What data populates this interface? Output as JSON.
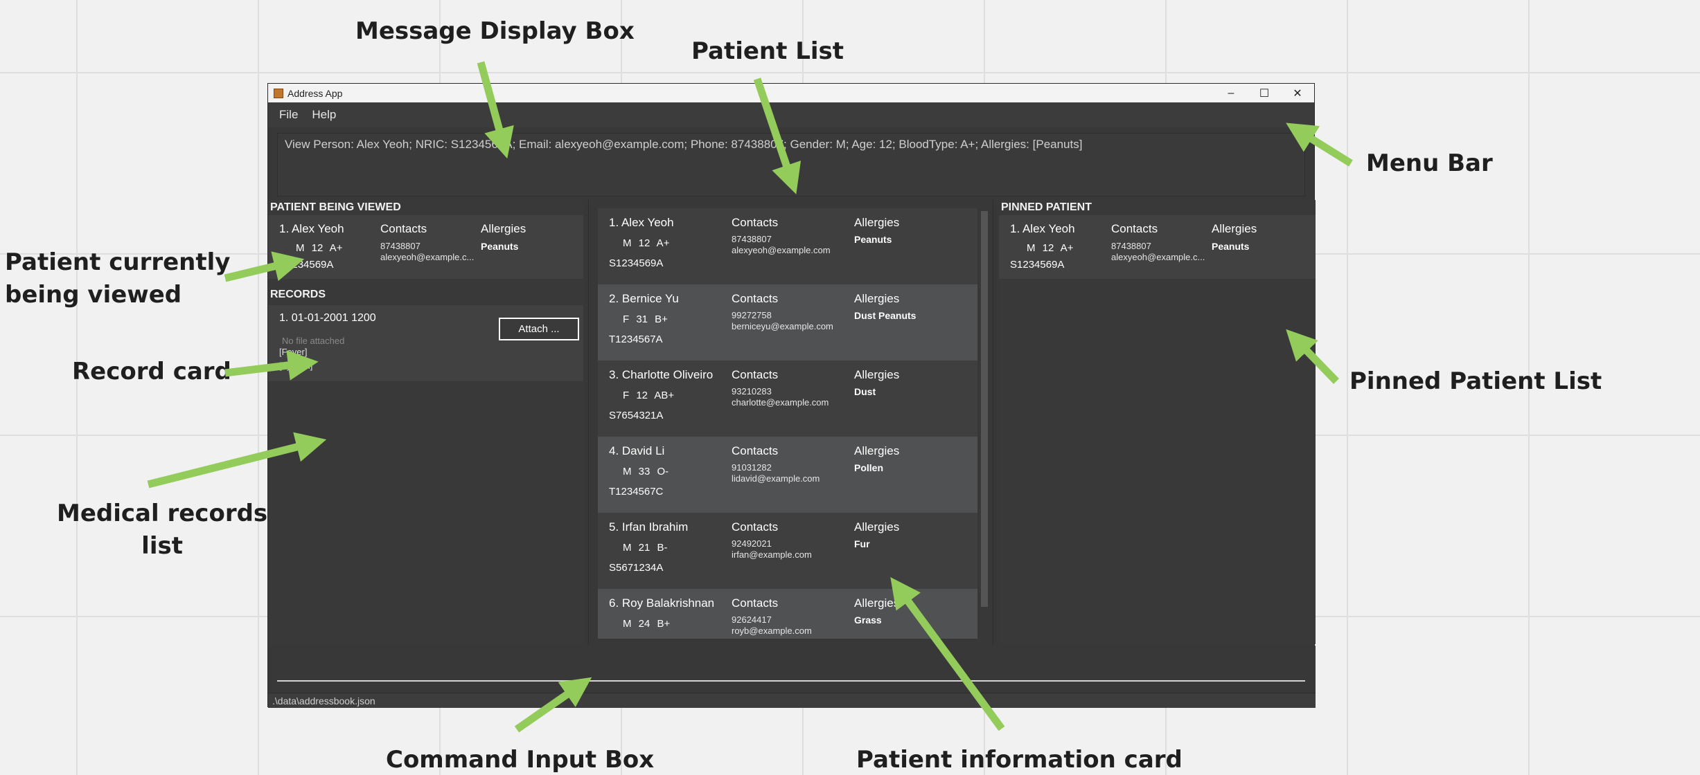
{
  "annotations": {
    "message_display_box": "Message Display Box",
    "patient_list": "Patient List",
    "menu_bar": "Menu Bar",
    "patient_viewed_line1": "Patient currently",
    "patient_viewed_line2": "being viewed",
    "record_card": "Record card",
    "medical_records_line1": "Medical records",
    "medical_records_line2": "list",
    "pinned_patient_list": "Pinned Patient List",
    "command_input_box": "Command Input Box",
    "patient_info_card": "Patient information card",
    "arrow_color": "#93cc5a"
  },
  "window": {
    "title": "Address App",
    "controls": {
      "minimize": "–",
      "maximize": "☐",
      "close": "✕"
    }
  },
  "menu": {
    "file": "File",
    "help": "Help"
  },
  "message": "View Person: Alex Yeoh; NRIC: S1234569A; Email: alexyeoh@example.com; Phone: 87438807; Gender: M; Age: 12; BloodType: A+; Allergies: [Peanuts]",
  "viewed": {
    "section_title": "PATIENT BEING VIEWED",
    "name": "1. Alex Yeoh",
    "attrs": "M 12 A+",
    "nric": "S1234569A",
    "contacts_title": "Contacts",
    "phone": "87438807",
    "email": "alexyeoh@example.c...",
    "allergies_title": "Allergies",
    "allergies": "Peanuts"
  },
  "records": {
    "section_title": "RECORDS",
    "items": [
      {
        "date": "1. 01-01-2001 1200",
        "file_status": "No file attached",
        "line1": "[Fever]",
        "line2": "[Tylenol]",
        "attach_label": "Attach ..."
      }
    ]
  },
  "patients": [
    {
      "name": "1. Alex Yeoh",
      "attrs": "M 12 A+",
      "nric": "S1234569A",
      "contacts_title": "Contacts",
      "phone": "87438807",
      "email": "alexyeoh@example.com",
      "allergies_title": "Allergies",
      "allergies": "Peanuts"
    },
    {
      "name": "2. Bernice Yu",
      "attrs": "F 31 B+",
      "nric": "T1234567A",
      "contacts_title": "Contacts",
      "phone": "99272758",
      "email": "berniceyu@example.com",
      "allergies_title": "Allergies",
      "allergies": "Dust Peanuts"
    },
    {
      "name": "3. Charlotte Oliveiro",
      "attrs": "F 12 AB+",
      "nric": "S7654321A",
      "contacts_title": "Contacts",
      "phone": "93210283",
      "email": "charlotte@example.com",
      "allergies_title": "Allergies",
      "allergies": "Dust"
    },
    {
      "name": "4. David Li",
      "attrs": "M 33 O-",
      "nric": "T1234567C",
      "contacts_title": "Contacts",
      "phone": "91031282",
      "email": "lidavid@example.com",
      "allergies_title": "Allergies",
      "allergies": "Pollen"
    },
    {
      "name": "5. Irfan Ibrahim",
      "attrs": "M 21 B-",
      "nric": "S5671234A",
      "contacts_title": "Contacts",
      "phone": "92492021",
      "email": "irfan@example.com",
      "allergies_title": "Allergies",
      "allergies": "Fur"
    },
    {
      "name": "6. Roy Balakrishnan",
      "attrs": "M 24 B+",
      "nric": "",
      "contacts_title": "Contacts",
      "phone": "92624417",
      "email": "royb@example.com",
      "allergies_title": "Allergies",
      "allergies": "Grass"
    }
  ],
  "pinned": {
    "section_title": "PINNED PATIENT",
    "name": "1. Alex Yeoh",
    "attrs": "M 12 A+",
    "nric": "S1234569A",
    "contacts_title": "Contacts",
    "phone": "87438807",
    "email": "alexyeoh@example.c...",
    "allergies_title": "Allergies",
    "allergies": "Peanuts"
  },
  "command": {
    "value": ""
  },
  "status": {
    "path": ".\\data\\addressbook.json"
  }
}
